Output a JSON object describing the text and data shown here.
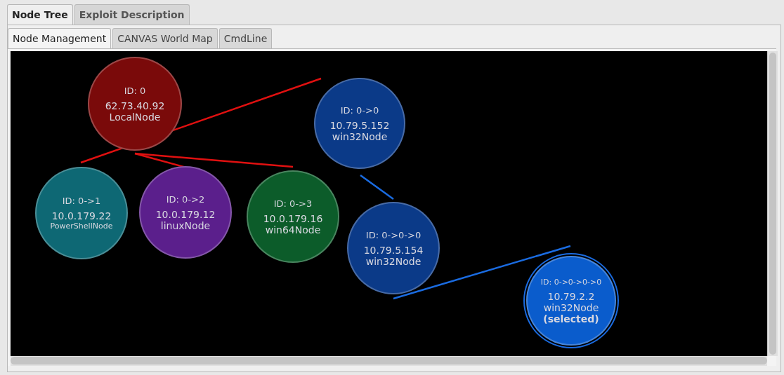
{
  "tabs": [
    {
      "label": "Node Tree",
      "selected": true
    },
    {
      "label": "Exploit Description",
      "selected": false
    }
  ],
  "subtabs": [
    {
      "label": "Node Management",
      "selected": true
    },
    {
      "label": "CANVAS World Map",
      "selected": false
    },
    {
      "label": "CmdLine",
      "selected": false
    }
  ],
  "nodes": [
    {
      "id": "ID: 0",
      "ip": "62.73.40.92",
      "type": "LocalNode",
      "color": "#7a0a0a",
      "selected": false
    },
    {
      "id": "ID: 0->0",
      "ip": "10.79.5.152",
      "type": "win32Node",
      "color": "#0b3a88",
      "selected": false
    },
    {
      "id": "ID: 0->1",
      "ip": "10.0.179.22",
      "type": "PowerShellNode",
      "color": "#0e6874",
      "selected": false
    },
    {
      "id": "ID: 0->2",
      "ip": "10.0.179.12",
      "type": "linuxNode",
      "color": "#5b1f8c",
      "selected": false
    },
    {
      "id": "ID: 0->3",
      "ip": "10.0.179.16",
      "type": "win64Node",
      "color": "#0c5c2a",
      "selected": false
    },
    {
      "id": "ID: 0->0->0",
      "ip": "10.79.5.154",
      "type": "win32Node",
      "color": "#0b3a88",
      "selected": false
    },
    {
      "id": "ID: 0->0->0->0",
      "ip": "10.79.2.2",
      "type": "win32Node",
      "note": "(selected)",
      "color": "#0a5ccc",
      "selected": true
    }
  ]
}
